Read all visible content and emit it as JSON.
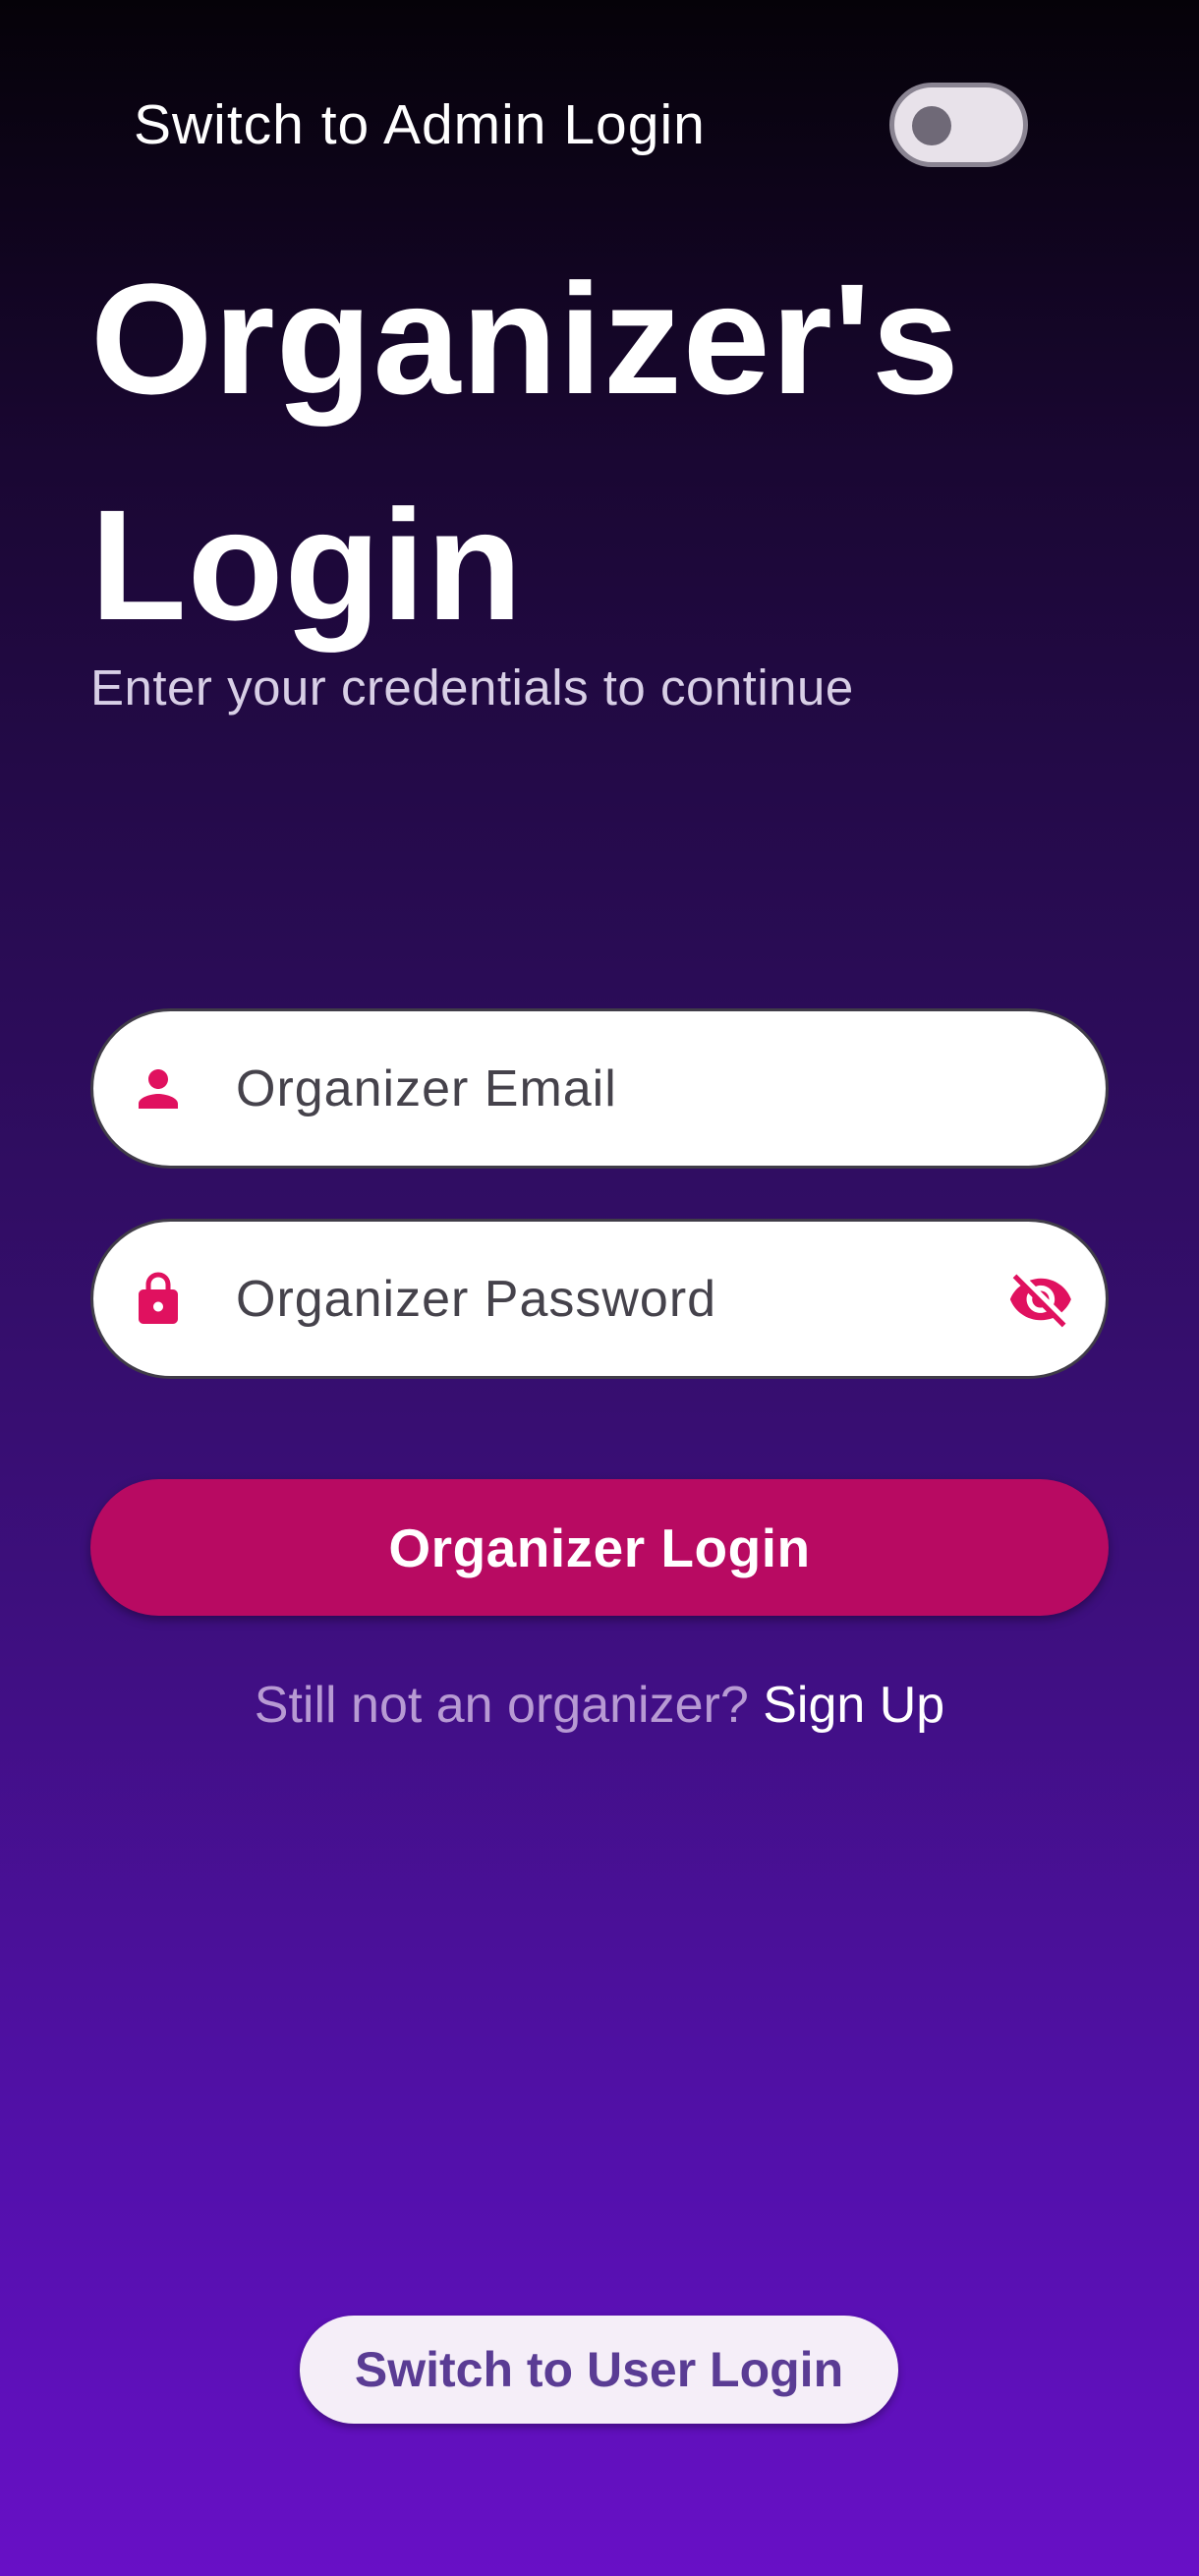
{
  "header": {
    "admin_toggle_label": "Switch to Admin Login",
    "admin_toggle_on": false
  },
  "title": "Organizer's Login",
  "subtitle": "Enter your credentials to continue",
  "form": {
    "email_placeholder": "Organizer Email",
    "email_icon": "person-icon",
    "password_placeholder": "Organizer Password",
    "password_icon": "lock-icon",
    "password_visibility_icon": "eye-off-icon",
    "submit_label": "Organizer Login"
  },
  "signup": {
    "prompt": "Still not an organizer?",
    "link": "Sign Up"
  },
  "footer": {
    "switch_user_label": "Switch to User Login"
  },
  "colors": {
    "accent": "#b80a62",
    "icon": "#e0115f"
  }
}
